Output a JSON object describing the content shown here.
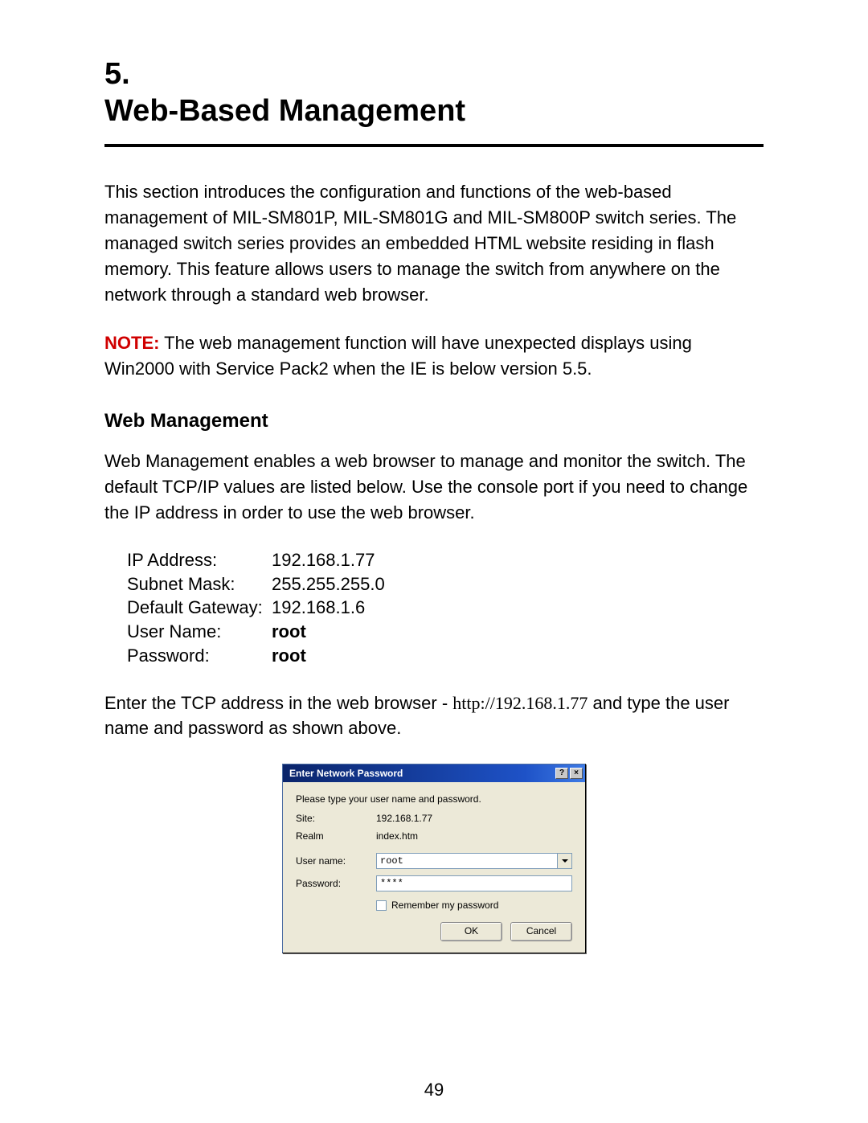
{
  "heading": {
    "chapter_number": "5.",
    "chapter_title": "Web-Based Management"
  },
  "intro_paragraph": "This section introduces the configuration and functions of the web-based management of MIL-SM801P, MIL-SM801G and MIL-SM800P switch series. The managed switch series provides an embedded HTML website residing in flash memory. This feature allows users to manage the switch from anywhere on the network through a standard web browser.",
  "note": {
    "label": "NOTE:",
    "text": " The web management function will have unexpected displays using Win2000 with Service Pack2 when the IE is below version 5.5."
  },
  "subheading": "Web Management",
  "web_mgmt_paragraph": "Web Management enables a web browser to manage and monitor the switch.  The default TCP/IP values are listed below. Use the console port if you need to change the IP address in order to use the web browser.",
  "defaults": {
    "ip_label": "IP Address:",
    "ip_value": "192.168.1.77",
    "subnet_label": "Subnet Mask:",
    "subnet_value": "255.255.255.0",
    "gateway_label": "Default Gateway:",
    "gateway_value": "192.168.1.6",
    "user_label": "User Name:",
    "user_value": "root",
    "pass_label": "Password:",
    "pass_value": "root"
  },
  "enter_paragraph_1": "Enter the TCP address in the web browser - ",
  "enter_url": "http://192.168.1.77",
  "enter_paragraph_2": " and type the user name and password as shown above.",
  "dialog": {
    "title": "Enter Network Password",
    "help_glyph": "?",
    "close_glyph": "×",
    "instruction": "Please type your user name and password.",
    "site_label": "Site:",
    "site_value": "192.168.1.77",
    "realm_label": "Realm",
    "realm_value": "index.htm",
    "username_label": "User name:",
    "username_value": "root",
    "password_label": "Password:",
    "password_value": "****",
    "remember_label": "Remember my password",
    "ok_label": "OK",
    "cancel_label": "Cancel"
  },
  "page_number": "49"
}
